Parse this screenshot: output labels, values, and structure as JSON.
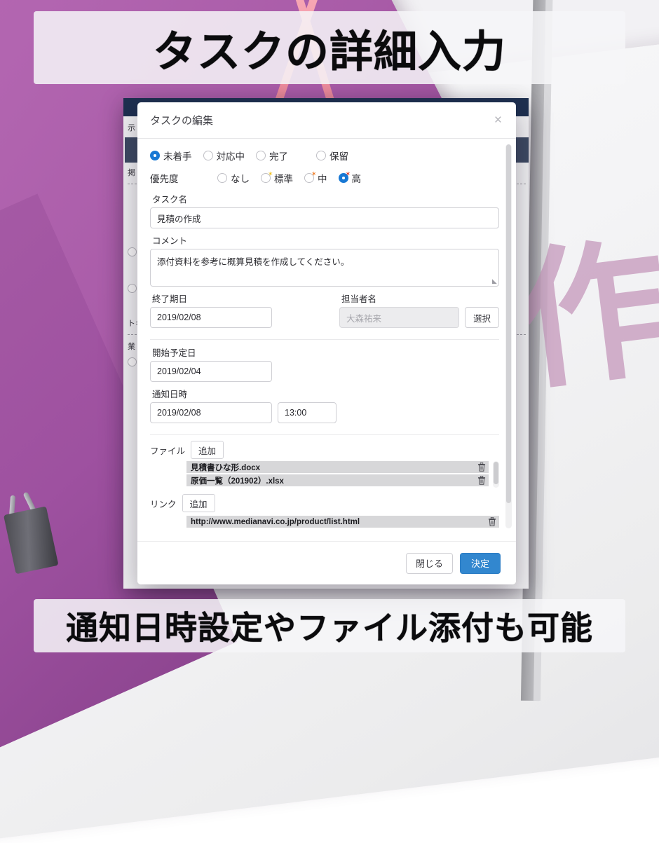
{
  "banner": {
    "top_text": "タスクの詳細入力",
    "bottom_text": "通知日時設定やファイル添付も可能"
  },
  "dialog": {
    "title": "タスクの編集",
    "close_label": "×",
    "status": {
      "options": [
        {
          "label": "未着手",
          "checked": true
        },
        {
          "label": "対応中",
          "checked": false
        },
        {
          "label": "完了",
          "checked": false
        },
        {
          "label": "保留",
          "checked": false
        }
      ]
    },
    "priority": {
      "label": "優先度",
      "options": [
        {
          "label": "なし",
          "checked": false,
          "star": "",
          "star_color": ""
        },
        {
          "label": "標準",
          "checked": false,
          "star": "✶",
          "star_color": "#f0c020"
        },
        {
          "label": "中",
          "checked": false,
          "star": "✶",
          "star_color": "#ef7a21"
        },
        {
          "label": "高",
          "checked": true,
          "star": "✶",
          "star_color": "#e03018"
        }
      ]
    },
    "task_name": {
      "label": "タスク名",
      "value": "見積の作成"
    },
    "comment": {
      "label": "コメント",
      "value": "添付資料を参考に概算見積を作成してください。"
    },
    "due_date": {
      "label": "終了期日",
      "value": "2019/02/08"
    },
    "assignee": {
      "label": "担当者名",
      "placeholder": "大森祐来",
      "value": "",
      "select_button": "選択"
    },
    "start_date": {
      "label": "開始予定日",
      "value": "2019/02/04"
    },
    "notify": {
      "label": "通知日時",
      "date_value": "2019/02/08",
      "time_value": "13:00"
    },
    "files": {
      "label": "ファイル",
      "add_button": "追加",
      "items": [
        {
          "name": "見積書ひな形.docx"
        },
        {
          "name": "原価一覧（201902）.xlsx"
        }
      ]
    },
    "links": {
      "label": "リンク",
      "add_button": "追加",
      "items": [
        {
          "name": "http://www.medianavi.co.jp/product/list.html"
        }
      ]
    },
    "footer": {
      "close_button": "閉じる",
      "confirm_button": "決定"
    }
  },
  "background_app": {
    "visible_fragments": [
      "示",
      "掲",
      "トキ",
      "業"
    ]
  },
  "decoration": {
    "kana": "作"
  },
  "colors": {
    "accent_blue": "#3287cf",
    "radio_blue": "#1878d4",
    "app_header_navy": "#1e3050",
    "paper_purple": "#b265b0",
    "deco_pink": "#c79cbe"
  }
}
